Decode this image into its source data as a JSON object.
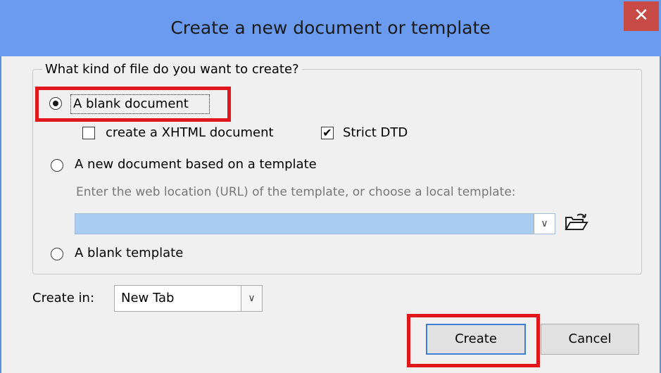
{
  "window": {
    "title": "Create a new document or template",
    "close_glyph": "✕"
  },
  "file_kind": {
    "legend": "What kind of file do you want to create?",
    "options": [
      {
        "label": "A blank document",
        "selected": true
      },
      {
        "label": "A new document based on a template",
        "selected": false
      },
      {
        "label": "A blank template",
        "selected": false
      }
    ],
    "xhtml_checkbox": {
      "label": "create a XHTML document",
      "checked": false
    },
    "strict_dtd_checkbox": {
      "label": "Strict DTD",
      "checked": true,
      "check_glyph": "✔"
    },
    "template_hint": "Enter the web location (URL) of the template, or choose a local template:",
    "template_url_value": ""
  },
  "create_in": {
    "label": "Create in:",
    "selected": "New Tab"
  },
  "buttons": {
    "create": "Create",
    "cancel": "Cancel"
  },
  "icons": {
    "close": "close-icon",
    "folder": "folder-open-icon",
    "dropdown": "chevron-down-icon"
  },
  "colors": {
    "titlebar": "#6b9bef",
    "highlight": "#e0161a",
    "url_field": "#a9cdf0",
    "close_button": "#c84a46"
  }
}
